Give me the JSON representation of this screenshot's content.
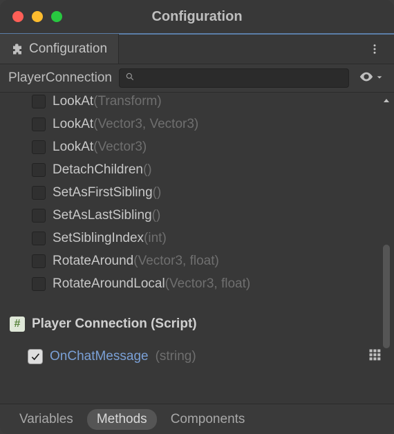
{
  "window": {
    "title": "Configuration"
  },
  "tab": {
    "label": "Configuration"
  },
  "breadcrumb": {
    "path": "PlayerConnection"
  },
  "search": {
    "placeholder": ""
  },
  "methods": [
    {
      "name": "LookAt",
      "params": "(Transform)",
      "checked": false,
      "clipped": true
    },
    {
      "name": "LookAt",
      "params": "(Vector3, Vector3)",
      "checked": false
    },
    {
      "name": "LookAt",
      "params": "(Vector3)",
      "checked": false
    },
    {
      "name": "DetachChildren",
      "params": "()",
      "checked": false
    },
    {
      "name": "SetAsFirstSibling",
      "params": "()",
      "checked": false
    },
    {
      "name": "SetAsLastSibling",
      "params": "()",
      "checked": false
    },
    {
      "name": "SetSiblingIndex",
      "params": "(int)",
      "checked": false
    },
    {
      "name": "RotateAround",
      "params": "(Vector3, float)",
      "checked": false
    },
    {
      "name": "RotateAroundLocal",
      "params": "(Vector3, float)",
      "checked": false
    }
  ],
  "script": {
    "header": "Player Connection (Script)",
    "methods": [
      {
        "name": "OnChatMessage",
        "params": "(string)",
        "checked": true,
        "highlight": true
      }
    ]
  },
  "footer_tabs": {
    "variables": "Variables",
    "methods": "Methods",
    "components": "Components",
    "active": "methods"
  }
}
